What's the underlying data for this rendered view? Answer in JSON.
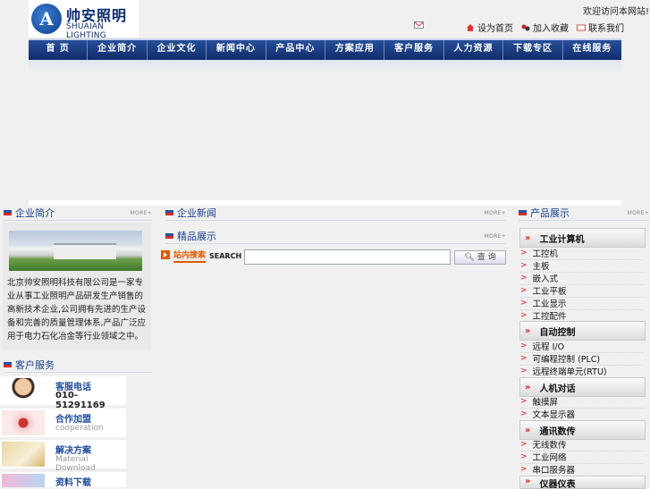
{
  "header": {
    "logo_mark": "A",
    "logo_cn": "帅安照明",
    "logo_en": "SHUAIAN LIGHTING",
    "welcome": "欢迎访问本网站!",
    "links": [
      {
        "label": "设为首页",
        "icon": "home-icon"
      },
      {
        "label": "加入收藏",
        "icon": "favorite-icon"
      },
      {
        "label": "联系我们",
        "icon": "mail-icon"
      }
    ]
  },
  "nav": [
    "首  页",
    "企业简介",
    "企业文化",
    "新闻中心",
    "产品中心",
    "方案应用",
    "客户服务",
    "人力资源",
    "下载专区",
    "在线服务"
  ],
  "sections": {
    "intro_title": "企业简介",
    "news_title": "企业新闻",
    "featured_title": "精品展示",
    "products_title": "产品展示",
    "service_title": "客户服务",
    "more": "MORE+"
  },
  "intro": {
    "text": "北京帅安照明科技有限公司是一家专业从事工业照明产品研发生产销售的高新技术企业,公司拥有先进的生产设备和完善的质量管理体系,产品广泛应用于电力石化冶金等行业领域之中。"
  },
  "service": [
    {
      "title": "客服电话",
      "sub": "010-51291169"
    },
    {
      "title": "合作加盟",
      "sub": "cooperation"
    },
    {
      "title": "解决方案",
      "sub": "Material Download"
    },
    {
      "title": "资料下载",
      "sub": ""
    }
  ],
  "search": {
    "label": "站内搜索",
    "label_en": "SEARCH",
    "placeholder": "",
    "button": "查 询"
  },
  "products": [
    {
      "category": "工业计算机",
      "items": [
        "工控机",
        "主板",
        "嵌入式",
        "工业平板",
        "工业显示",
        "工控配件"
      ]
    },
    {
      "category": "自动控制",
      "items": [
        "远程 I/O",
        "可编程控制 (PLC)",
        "远程终端单元(RTU)"
      ]
    },
    {
      "category": "人机对话",
      "items": [
        "触摸屏",
        "文本显示器"
      ]
    },
    {
      "category": "通讯数传",
      "items": [
        "无线数传",
        "工业网络",
        "串口服务器"
      ]
    },
    {
      "category": "仪器仪表",
      "items": []
    }
  ]
}
